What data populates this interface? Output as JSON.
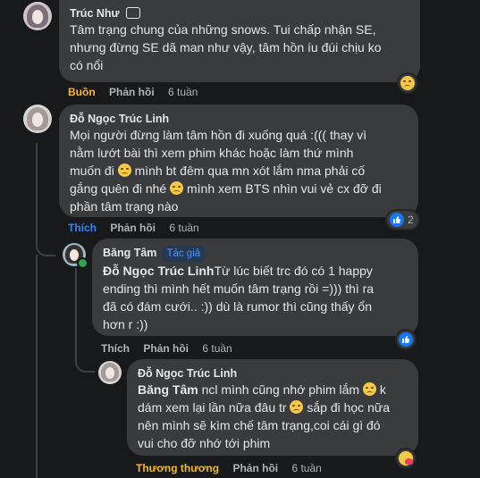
{
  "comment1": {
    "name": "Trúc Như",
    "text_1": "Tâm trạng chung của những snows. Tui chấp nhận SE,",
    "text_2": "nhưng đừng SE dã man như vậy, tâm hồn íu đúi chịu ko",
    "text_3": "có nổi",
    "reaction_label": "Buồn",
    "reply_label": "Phản hồi",
    "time": "6 tuần",
    "reaction_icon": "sad-face-icon"
  },
  "comment2": {
    "name": "Đỗ Ngọc Trúc Linh",
    "text_1": "Mọi người đừng làm tâm hồn đi xuống quá :((( thay vì",
    "text_2": "nằm lướt bài thì xem phim khác hoặc làm thứ mình",
    "text_3a": "muốn đi",
    "text_3b": "mình bt đêm qua mn xót lắm nma phải cố",
    "text_4a": "gắng quên đi nhé",
    "text_4b": "mình xem BTS nhìn vui vẻ cx đỡ đi",
    "text_5": "phần tâm trạng nào",
    "reaction_label": "Thích",
    "reply_label": "Phản hồi",
    "time": "6 tuần",
    "reaction_count": "2",
    "reaction_icon": "like-icon"
  },
  "reply1": {
    "name": "Băng Tâm",
    "author_badge": "Tác giả",
    "mention": "Đỗ Ngọc Trúc Linh",
    "text_1": "Từ lúc biết trc đó có 1 happy",
    "text_2": "ending thì mình hết muốn tâm trạng rồi =))) thì ra",
    "text_3": "đã có đám cưới.. :)) dù là rumor thì cũng thấy ổn",
    "text_4": "hơn r :))",
    "reaction_label": "Thích",
    "reply_label": "Phản hồi",
    "time": "6 tuần",
    "reaction_icon": "like-icon"
  },
  "reply2": {
    "name": "Đỗ Ngọc Trúc Linh",
    "mention": "Băng Tâm",
    "text_1": " ncl mình cũng nhớ phim lắm",
    "text_1b": "k",
    "text_2a": "dám xem lại lần nữa đâu tr",
    "text_2b": "sắp đi học nữa",
    "text_3": "nên mình sẽ kìm chế tâm trạng,coi cái gì đó",
    "text_4": "vui cho đỡ nhớ tới phim",
    "reaction_label": "Thương thương",
    "reply_label": "Phản hồi",
    "time": "6 tuần",
    "reaction_icon": "care-face-icon"
  },
  "colors": {
    "background": "#18191a",
    "bubble": "#3a3b3c",
    "text": "#e4e6eb",
    "secondary": "#b0b3b8",
    "like": "#2d88ff",
    "sad": "#f7b928",
    "care": "#f7b928"
  }
}
